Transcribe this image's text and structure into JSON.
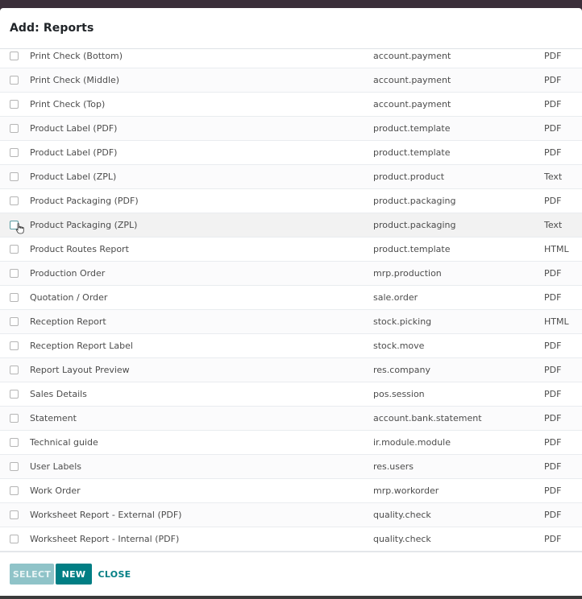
{
  "dialog": {
    "title": "Add: Reports"
  },
  "rows": [
    {
      "name": "Print Check (Bottom)",
      "model": "account.payment",
      "type": "PDF"
    },
    {
      "name": "Print Check (Middle)",
      "model": "account.payment",
      "type": "PDF"
    },
    {
      "name": "Print Check (Top)",
      "model": "account.payment",
      "type": "PDF"
    },
    {
      "name": "Product Label (PDF)",
      "model": "product.template",
      "type": "PDF"
    },
    {
      "name": "Product Label (PDF)",
      "model": "product.template",
      "type": "PDF"
    },
    {
      "name": "Product Label (ZPL)",
      "model": "product.product",
      "type": "Text"
    },
    {
      "name": "Product Packaging (PDF)",
      "model": "product.packaging",
      "type": "PDF"
    },
    {
      "name": "Product Packaging (ZPL)",
      "model": "product.packaging",
      "type": "Text"
    },
    {
      "name": "Product Routes Report",
      "model": "product.template",
      "type": "HTML"
    },
    {
      "name": "Production Order",
      "model": "mrp.production",
      "type": "PDF"
    },
    {
      "name": "Quotation / Order",
      "model": "sale.order",
      "type": "PDF"
    },
    {
      "name": "Reception Report",
      "model": "stock.picking",
      "type": "HTML"
    },
    {
      "name": "Reception Report Label",
      "model": "stock.move",
      "type": "PDF"
    },
    {
      "name": "Report Layout Preview",
      "model": "res.company",
      "type": "PDF"
    },
    {
      "name": "Sales Details",
      "model": "pos.session",
      "type": "PDF"
    },
    {
      "name": "Statement",
      "model": "account.bank.statement",
      "type": "PDF"
    },
    {
      "name": "Technical guide",
      "model": "ir.module.module",
      "type": "PDF"
    },
    {
      "name": "User Labels",
      "model": "res.users",
      "type": "PDF"
    },
    {
      "name": "Work Order",
      "model": "mrp.workorder",
      "type": "PDF"
    },
    {
      "name": "Worksheet Report - External (PDF)",
      "model": "quality.check",
      "type": "PDF"
    },
    {
      "name": "Worksheet Report - Internal (PDF)",
      "model": "quality.check",
      "type": "PDF"
    }
  ],
  "footer": {
    "select_label": "SELECT",
    "new_label": "NEW",
    "close_label": "CLOSE"
  },
  "colors": {
    "primary": "#017e84",
    "primary_disabled": "#8fc3c8"
  },
  "hover_row_index": 7
}
